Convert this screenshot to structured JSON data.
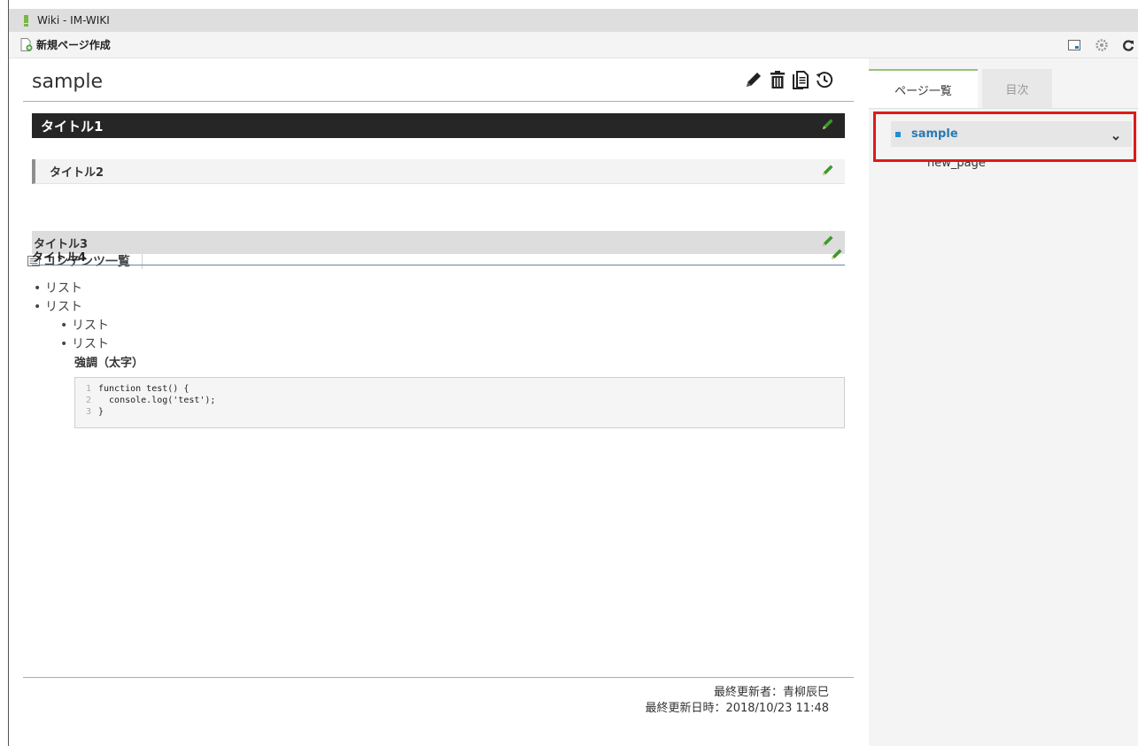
{
  "window": {
    "title": "Wiki - IM-WIKI"
  },
  "toolbar": {
    "contents_list": "コンテンツ一覧",
    "new_page": "新規ページ作成"
  },
  "page": {
    "title": "sample",
    "headings": {
      "h1": "タイトル1",
      "h2": "タイトル2",
      "h3": "タイトル3",
      "h4": "タイトル4"
    },
    "list": [
      "リスト",
      "リスト"
    ],
    "sublist": [
      "リスト",
      "リスト"
    ],
    "bold_text": "強調（太字）",
    "code": [
      {
        "num": "1",
        "text": "function test() {"
      },
      {
        "num": "2",
        "text": "  console.log('test');"
      },
      {
        "num": "3",
        "text": "}"
      }
    ],
    "last_updated_by": "最終更新者：青柳辰巳",
    "last_updated_at": "最終更新日時：2018/10/23 11:48"
  },
  "sidebar": {
    "tabs": [
      "ページ一覧",
      "目次"
    ],
    "tree": {
      "root": "sample",
      "children": [
        "new_page"
      ]
    }
  },
  "colors": {
    "accent_green": "#96c27d",
    "link_blue": "#2a79b4",
    "highlight_red": "#e0191b",
    "pen_green": "#3c9a2a"
  }
}
